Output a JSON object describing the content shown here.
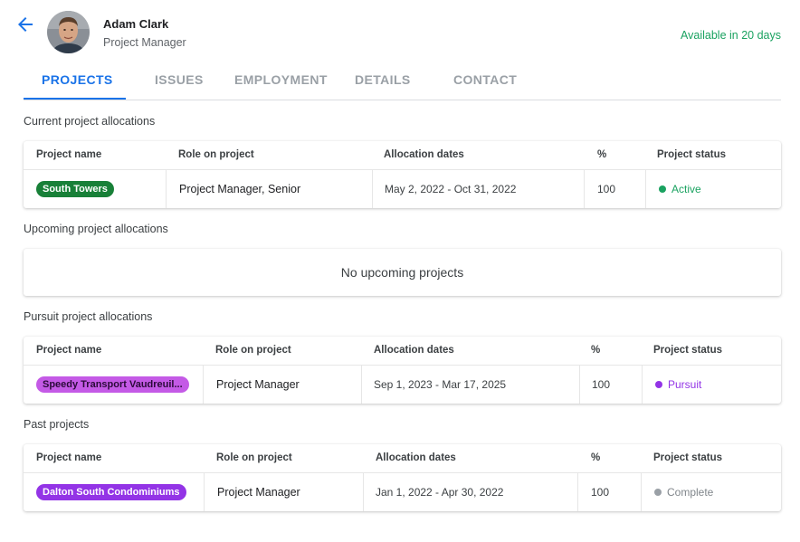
{
  "header": {
    "name": "Adam Clark",
    "title": "Project Manager",
    "availability": "Available in 20 days"
  },
  "tabs": [
    {
      "label": "PROJECTS",
      "active": true
    },
    {
      "label": "ISSUES",
      "active": false
    },
    {
      "label": "EMPLOYMENT",
      "active": false
    },
    {
      "label": "DETAILS",
      "active": false
    },
    {
      "label": "CONTACT",
      "active": false
    }
  ],
  "colors": {
    "accent": "#1a73e8",
    "available": "#1aa260",
    "chip_active": "#188038",
    "chip_pursuit": "#c45ae6",
    "chip_past": "#9334e6",
    "status_active": "#1aa260",
    "status_pursuit": "#9334e6",
    "status_complete": "#9aa0a6"
  },
  "columns": {
    "project_name": "Project name",
    "role": "Role on project",
    "dates": "Allocation dates",
    "percent": "%",
    "status": "Project status"
  },
  "current": {
    "label": "Current project allocations",
    "row": {
      "project": "South Towers",
      "role": "Project Manager, Senior",
      "dates": "May 2, 2022 - Oct 31, 2022",
      "percent": "100",
      "status": "Active"
    }
  },
  "upcoming": {
    "label": "Upcoming project allocations",
    "empty_text": "No upcoming projects"
  },
  "pursuit": {
    "label": "Pursuit project allocations",
    "row": {
      "project": "Speedy Transport Vaudreuil...",
      "role": "Project Manager",
      "dates": "Sep 1, 2023 - Mar 17, 2025",
      "percent": "100",
      "status": "Pursuit"
    }
  },
  "past": {
    "label": "Past projects",
    "row": {
      "project": "Dalton South Condominiums",
      "role": "Project Manager",
      "dates": "Jan 1, 2022 - Apr 30, 2022",
      "percent": "100",
      "status": "Complete"
    }
  }
}
